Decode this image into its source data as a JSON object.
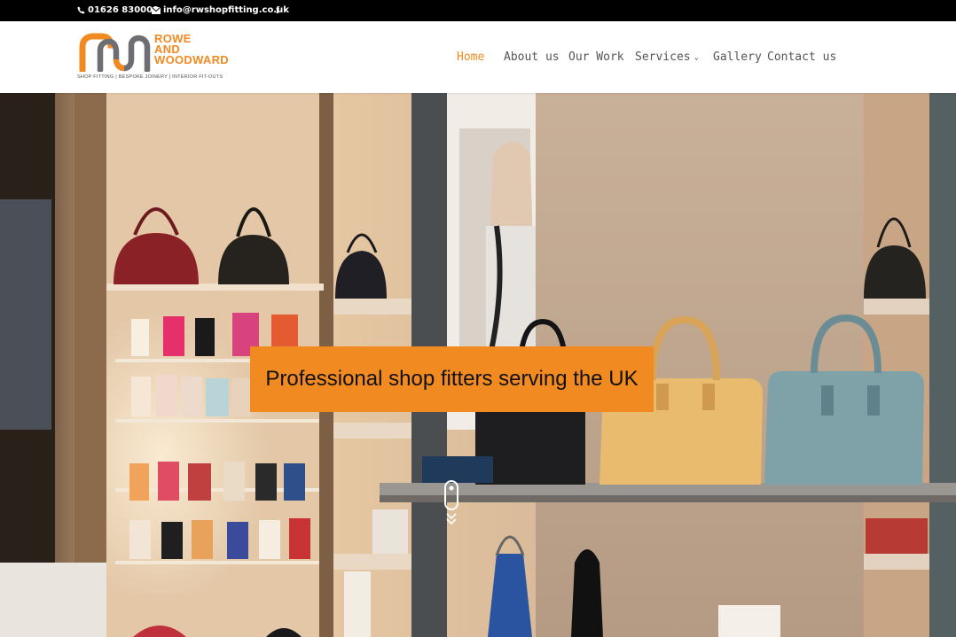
{
  "topbar": {
    "phone": "01626 830000",
    "email": "info@rwshopfitting.co.uk",
    "social_icon": "facebook-icon"
  },
  "logo": {
    "line1": "ROWE",
    "line2": "AND",
    "line3": "WOODWARD",
    "tagline": "SHOP FITTING | BESPOKE JOINERY | INTERIOR FIT-OUTS",
    "mark_vertical": "AND"
  },
  "nav": {
    "home": "Home",
    "about": "About us",
    "work": "Our Work",
    "services": "Services",
    "gallery": "Gallery",
    "contact": "Contact us"
  },
  "hero": {
    "heading": "Professional shop fitters serving the UK"
  },
  "colors": {
    "accent": "#f28a22",
    "topbar": "#000000",
    "nav_text": "#555555"
  }
}
